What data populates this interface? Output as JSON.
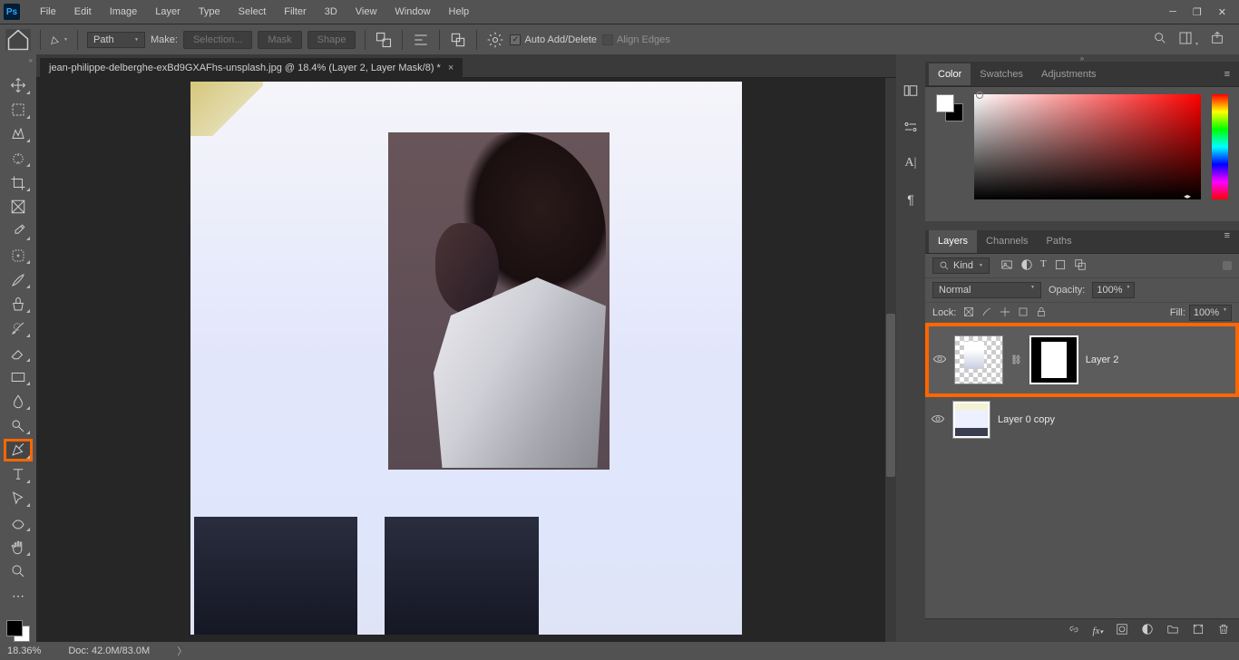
{
  "menubar": [
    "File",
    "Edit",
    "Image",
    "Layer",
    "Type",
    "Select",
    "Filter",
    "3D",
    "View",
    "Window",
    "Help"
  ],
  "options": {
    "mode": "Path",
    "make_label": "Make:",
    "selection_btn": "Selection...",
    "mask_btn": "Mask",
    "shape_btn": "Shape",
    "auto_add_delete": "Auto Add/Delete",
    "align_edges": "Align Edges"
  },
  "document": {
    "tab_title": "jean-philippe-delberghe-exBd9GXAFhs-unsplash.jpg @ 18.4% (Layer 2, Layer Mask/8) *"
  },
  "panels": {
    "color_tabs": [
      "Color",
      "Swatches",
      "Adjustments"
    ],
    "layers_tabs": [
      "Layers",
      "Channels",
      "Paths"
    ]
  },
  "layers": {
    "kind_label": "Kind",
    "blend_mode": "Normal",
    "opacity_label": "Opacity:",
    "opacity_value": "100%",
    "lock_label": "Lock:",
    "fill_label": "Fill:",
    "fill_value": "100%",
    "items": [
      {
        "name": "Layer 2"
      },
      {
        "name": "Layer 0 copy"
      }
    ]
  },
  "status": {
    "zoom": "18.36%",
    "doc_info": "Doc: 42.0M/83.0M"
  }
}
